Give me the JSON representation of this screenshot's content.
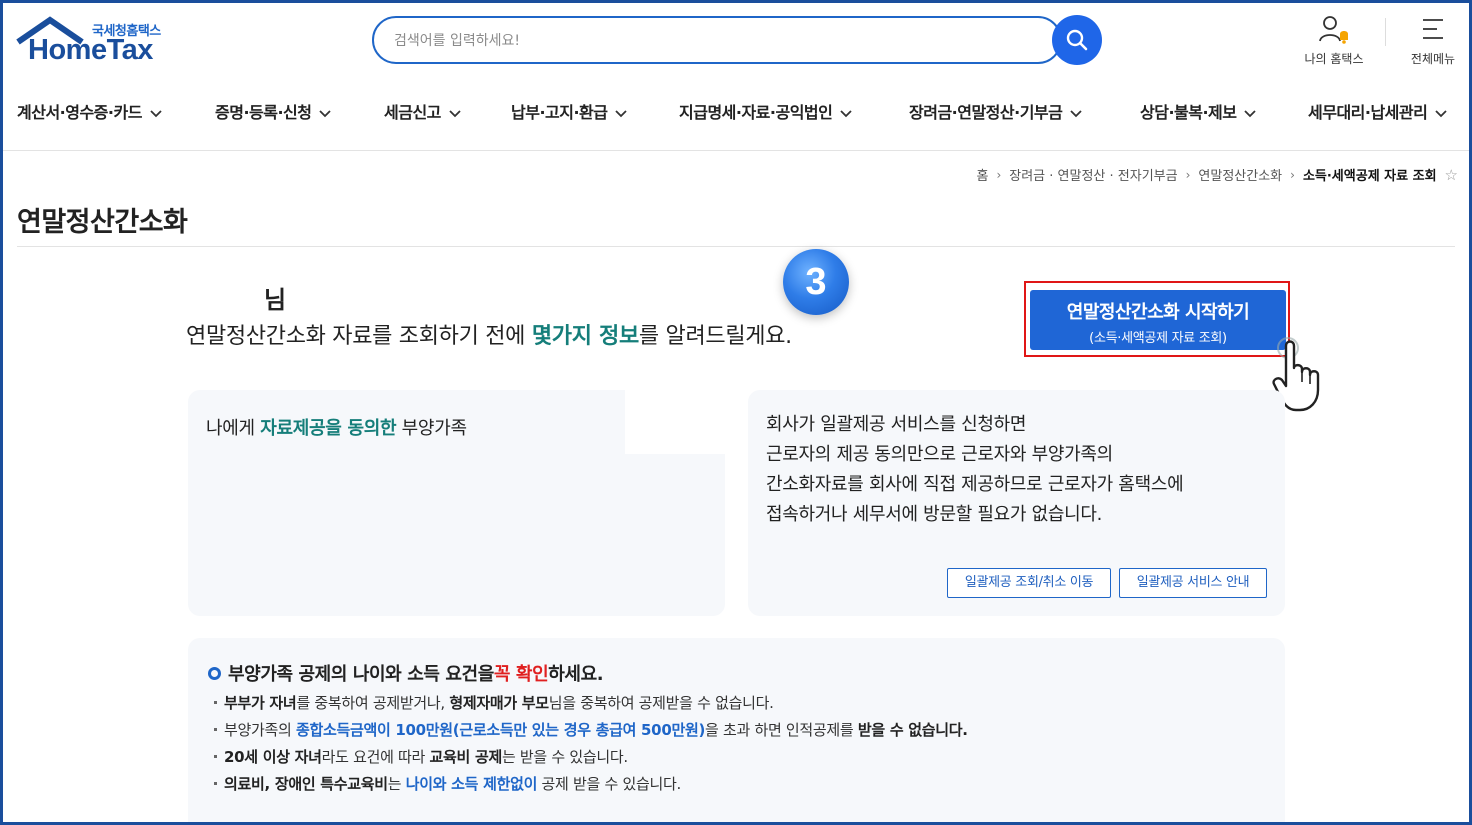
{
  "header": {
    "logo_sub": "국세청홈택스",
    "logo_main": "HomeTax",
    "search_placeholder": "검색어를 입력하세요!",
    "my_hometax": "나의 홈택스",
    "all_menu": "전체메뉴"
  },
  "nav": {
    "items": [
      {
        "label": "계산서·영수증·카드"
      },
      {
        "label": "증명·등록·신청"
      },
      {
        "label": "세금신고"
      },
      {
        "label": "납부·고지·환급"
      },
      {
        "label": "지급명세·자료·공익법인"
      },
      {
        "label": "장려금·연말정산·기부금"
      },
      {
        "label": "상담·불복·제보"
      },
      {
        "label": "세무대리·납세관리"
      }
    ]
  },
  "breadcrumb": {
    "items": [
      "홈",
      "장려금 · 연말정산 · 전자기부금",
      "연말정산간소화"
    ],
    "current": "소득·세액공제 자료 조회"
  },
  "page_title": "연말정산간소화",
  "intro": {
    "step_number": "3",
    "user_suffix": "님",
    "text_before": "연말정산간소화 자료를 조회하기 전에 ",
    "text_highlight": "몇가지 정보",
    "text_after": "를 알려드릴게요."
  },
  "start_button": {
    "line1": "연말정산간소화 시작하기",
    "line2": "(소득·세액공제 자료 조회)"
  },
  "card_left": {
    "text_before": "나에게 ",
    "text_highlight": "자료제공을 동의한",
    "text_after": " 부양가족"
  },
  "card_right": {
    "lines": [
      "회사가 일괄제공 서비스를 신청하면",
      "근로자의 제공 동의만으로 근로자와 부양가족의",
      "간소화자료를 회사에 직접 제공하므로 근로자가 홈택스에",
      "접속하거나 세무서에 방문할 필요가 없습니다."
    ],
    "btn_bulk_lookup": "일괄제공 조회/취소 이동",
    "btn_bulk_guide": "일괄제공 서비스 안내"
  },
  "notice": {
    "head_before": "부양가족 공제의 나이와 소득 요건을 ",
    "head_red1": "꼭",
    "head_space": " ",
    "head_red2": "확인",
    "head_after": "하세요.",
    "items": [
      {
        "b1": "부부가 자녀",
        "t1": "를 중복하여 공제받거나, ",
        "b2": "형제자매가 부모",
        "t2": "님을 중복하여 공제받을 수 없습니다."
      },
      {
        "t1": "부양가족의 ",
        "blue": "종합소득금액이 100만원(근로소득만 있는 경우 총급여 500만원)",
        "t2": "을 초과 하면 인적공제를 ",
        "b1": "받을 수 없습니다."
      },
      {
        "b1": "20세 이상 자녀",
        "t1": "라도 요건에 따라 ",
        "b2": "교육비 공제",
        "t2": "는 받을 수 있습니다."
      },
      {
        "b1": "의료비, 장애인 특수교육비",
        "t1": "는 ",
        "blue": "나이와 소득 제한없이",
        "t2": " 공제 받을 수 있습니다."
      }
    ]
  },
  "colors": {
    "brand": "#1a4e9c",
    "accent": "#1f66d6",
    "highlight_teal": "#157e7a",
    "alert_red": "#e02020"
  }
}
